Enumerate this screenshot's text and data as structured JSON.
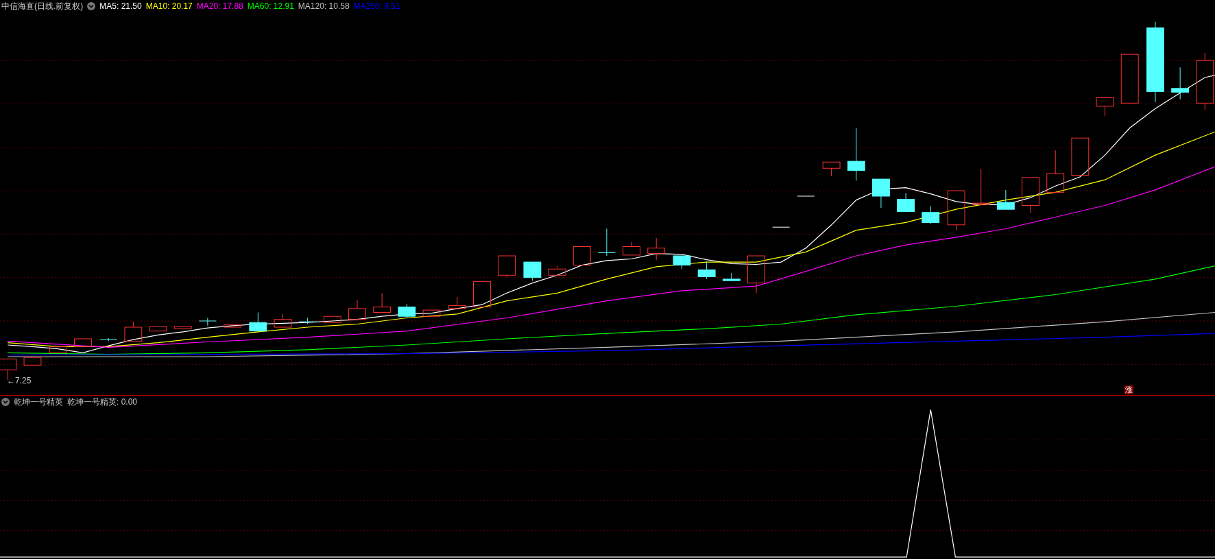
{
  "main_panel": {
    "title": "中信海直(日线.前复权)",
    "moving_averages": [
      {
        "text": "MA5: 21.50",
        "color": "#ffffff"
      },
      {
        "text": "MA10: 20.17",
        "color": "#ffff00"
      },
      {
        "text": "MA20: 17.88",
        "color": "#ff00ff"
      },
      {
        "text": "MA60: 12.91",
        "color": "#00ff00"
      },
      {
        "text": "MA120: 10.58",
        "color": "#c0c0c0"
      },
      {
        "text": "MA250: 9.51",
        "color": "#0000ff"
      }
    ],
    "low_price_marker": "←7.25",
    "badge": "涨"
  },
  "indicator_panel": {
    "title": "乾坤一号精英",
    "reading": "乾坤一号精英: 0.00"
  }
}
